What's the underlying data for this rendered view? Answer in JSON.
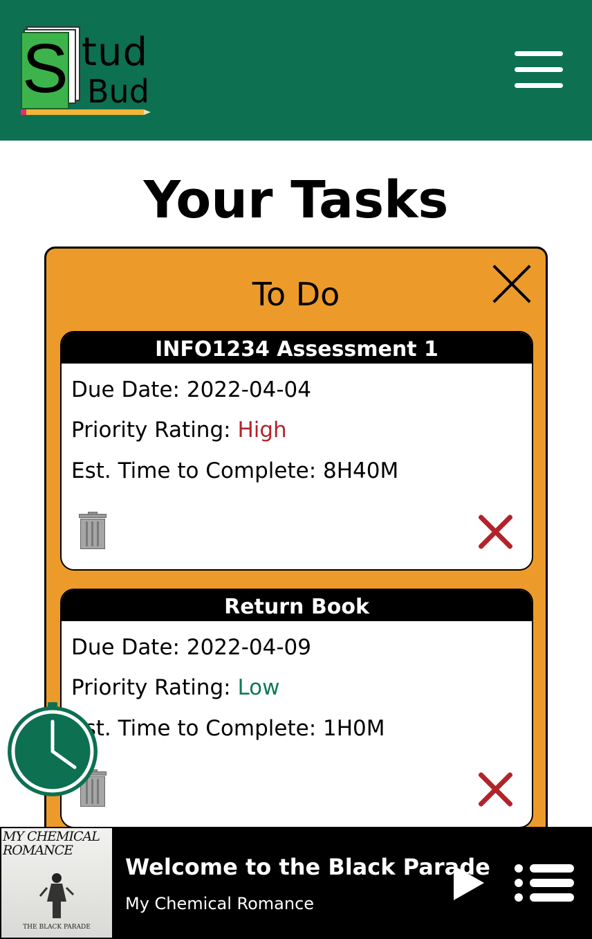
{
  "header": {
    "logo": {
      "initial": "S",
      "line1": "tud",
      "line2": "Bud"
    },
    "menu_icon": "hamburger-menu-icon",
    "colors": {
      "background": "#0d7050"
    }
  },
  "page_title": "Your Tasks",
  "panel": {
    "title": "To Do",
    "close_icon": "close-icon",
    "colors": {
      "background": "#ec9b2a",
      "high": "#b3232a",
      "low": "#0f7a53"
    },
    "tasks": [
      {
        "title": "INFO1234 Assessment 1",
        "due_label": "Due Date: ",
        "due_value": "2022-04-04",
        "priority_label": "Priority Rating: ",
        "priority_value": "High",
        "time_label": "Est. Time to Complete: ",
        "time_value": "8H40M"
      },
      {
        "title": "Return Book",
        "due_label": "Due Date: ",
        "due_value": "2022-04-09",
        "priority_label": "Priority Rating: ",
        "priority_value": "Low",
        "time_label": "Est. Time to Complete: ",
        "time_value": "1H0M"
      }
    ]
  },
  "timer_button": {
    "icon": "clock-icon"
  },
  "player": {
    "album_text": "MY CHEMICAL ROMANCE",
    "album_subtitle": "THE BLACK PARADE",
    "song_title": "Welcome to the Black Parade",
    "artist": "My Chemical Romance",
    "play_icon": "play-icon",
    "queue_icon": "queue-list-icon"
  }
}
